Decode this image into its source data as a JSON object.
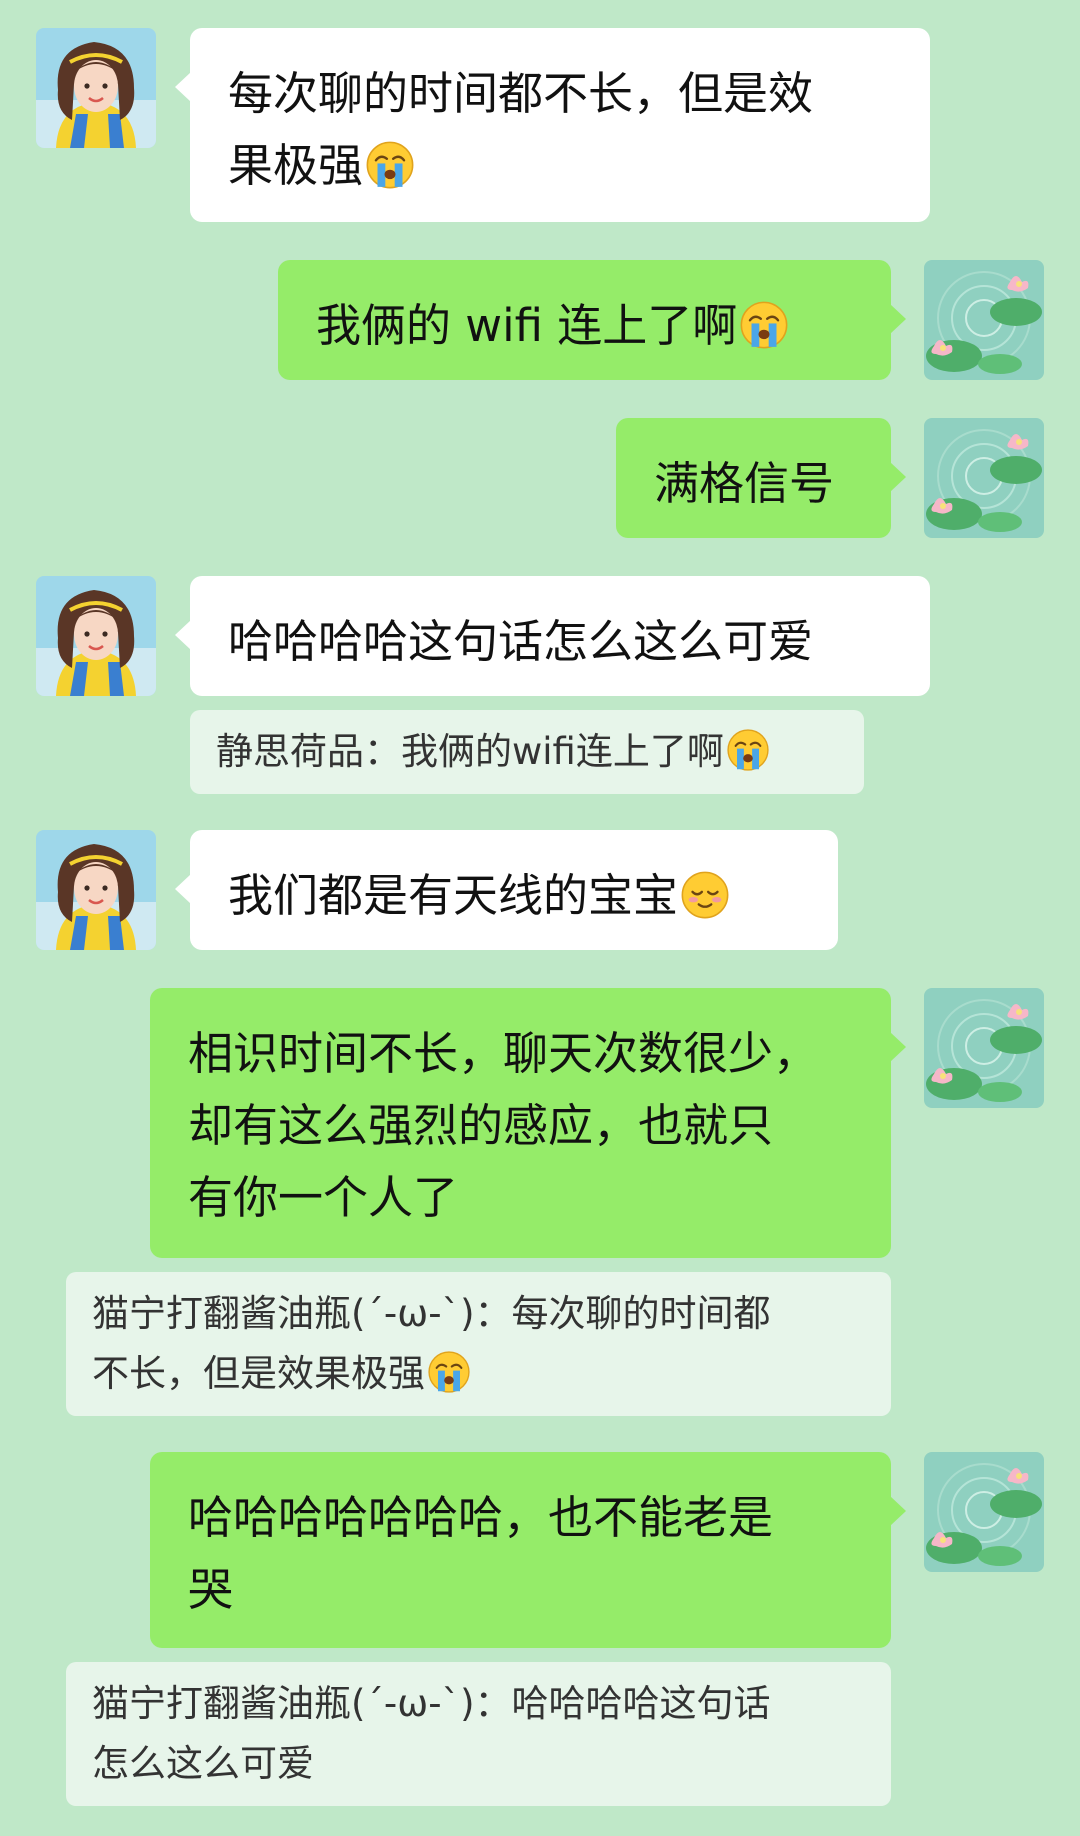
{
  "messages": [
    {
      "id": 1,
      "side": "left",
      "text": "每次聊的时间都不长，但是效果极强",
      "emoji": "loudly-crying-face-icon"
    },
    {
      "id": 2,
      "side": "right",
      "text": "我俩的 wifi 连上了啊",
      "emoji": "loudly-crying-face-icon"
    },
    {
      "id": 3,
      "side": "right",
      "text": "满格信号"
    },
    {
      "id": 4,
      "side": "left",
      "text": "哈哈哈哈这句话怎么这么可爱"
    },
    {
      "id": 5,
      "side": "left",
      "quote": "静思荷品：我俩的wifi连上了啊",
      "quote_emoji": "loudly-crying-face-icon"
    },
    {
      "id": 6,
      "side": "left",
      "text": "我们都是有天线的宝宝",
      "emoji": "smiling-face-icon"
    },
    {
      "id": 7,
      "side": "right",
      "text": "相识时间不长，聊天次数很少，却有这么强烈的感应，也就只有你一个人了"
    },
    {
      "id": 8,
      "side": "right",
      "quote": "猫宁打翻酱油瓶(´-ω-`)：每次聊的时间都不长，但是效果极强",
      "quote_emoji": "loudly-crying-face-icon"
    },
    {
      "id": 9,
      "side": "right",
      "text": "哈哈哈哈哈哈哈，也不能老是哭"
    },
    {
      "id": 10,
      "side": "right",
      "quote": "猫宁打翻酱油瓶(´-ω-`)：哈哈哈哈这句话怎么这么可爱"
    }
  ],
  "lines": {
    "m1_l1": "每次聊的时间都不长，但是效",
    "m1_l2": "果极强",
    "m2": "我俩的 wifi 连上了啊",
    "m3": "满格信号",
    "m4": "哈哈哈哈这句话怎么这么可爱",
    "q1": "静思荷品：我俩的wifi连上了啊",
    "m6": "我们都是有天线的宝宝",
    "m7_l1": "相识时间不长，聊天次数很少，",
    "m7_l2": "却有这么强烈的感应，也就只",
    "m7_l3": "有你一个人了",
    "q2_l1": "猫宁打翻酱油瓶(´-ω-`)：每次聊的时间都",
    "q2_l2": "不长，但是效果极强",
    "m9_l1": "哈哈哈哈哈哈哈，也不能老是",
    "m9_l2": "哭",
    "q3_l1": "猫宁打翻酱油瓶(´-ω-`)：哈哈哈哈这句话",
    "q3_l2": "怎么这么可爱"
  },
  "avatars": {
    "left": "girl-avatar",
    "right": "lotus-pond-avatar"
  },
  "colors": {
    "background": "#bfe8c8",
    "incoming_bubble": "#ffffff",
    "outgoing_bubble": "#95ec69",
    "quote_background": "#e7f5ea"
  }
}
